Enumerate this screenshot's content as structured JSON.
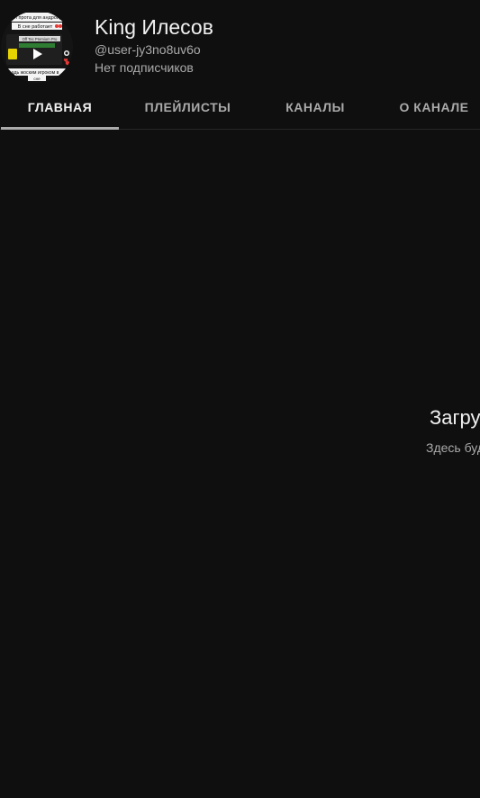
{
  "channel": {
    "name": "King Илесов",
    "handle": "@user-jy3no8uv6o",
    "subscribers": "Нет подписчиков",
    "avatar": {
      "line1": "ел прота для андроид",
      "line2": "В сне работает",
      "line3": "Off Tec Premium Pro",
      "line4": "адь жоским игроком в",
      "line5": "сне"
    }
  },
  "tabs": [
    {
      "label": "ГЛАВНАЯ",
      "active": true
    },
    {
      "label": "ПЛЕЙЛИСТЫ",
      "active": false
    },
    {
      "label": "КАНАЛЫ",
      "active": false
    },
    {
      "label": "О КАНАЛЕ",
      "active": false
    }
  ],
  "empty_state": {
    "title": "Загру",
    "subtitle": "Здесь буд"
  },
  "colors": {
    "background": "#0f0f0f",
    "text_primary": "#f1f1f1",
    "text_secondary": "#aaaaaa",
    "divider": "#272727"
  }
}
